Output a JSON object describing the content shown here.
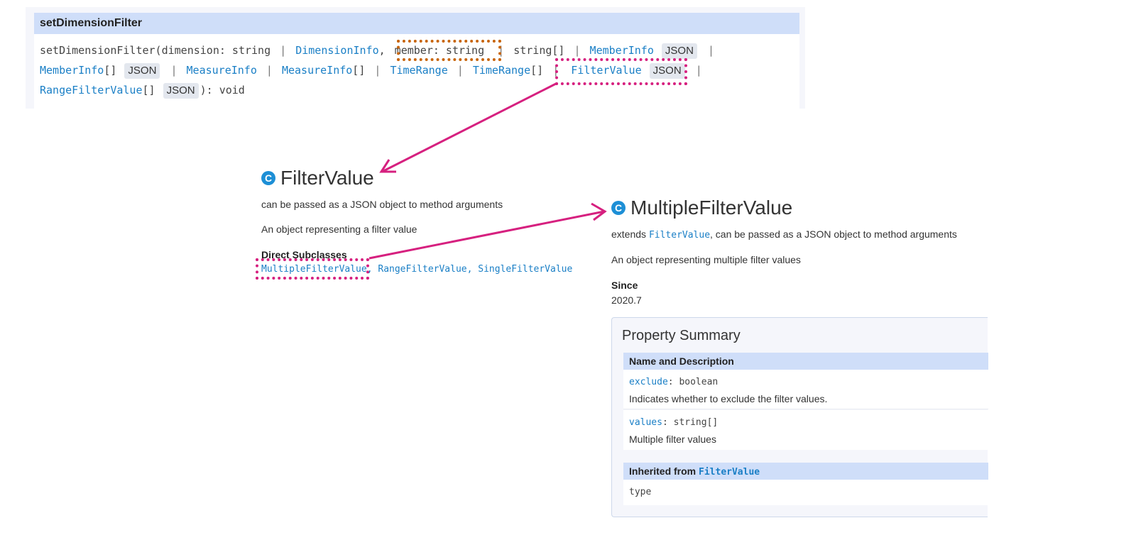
{
  "signature": {
    "header_title": "setDimensionFilter",
    "line1": {
      "fn": "setDimensionFilter(dimension: string",
      "sep1": "|",
      "dimension_info": "DimensionInfo",
      "comma": ",",
      "member_param": "member: string",
      "sep2": "|",
      "string_arr": "string[]",
      "sep3": "|",
      "member_info": "MemberInfo",
      "json1": "JSON",
      "sep4": "|"
    },
    "line2": {
      "member_info_arr": "MemberInfo",
      "brackets1": "[]",
      "json2": "JSON",
      "sep5": "|",
      "measure_info": "MeasureInfo",
      "sep6": "|",
      "measure_info_arr": "MeasureInfo",
      "brackets2": "[]",
      "sep7": "|",
      "time_range": "TimeRange",
      "sep8": "|",
      "time_range_arr": "TimeRange",
      "brackets3": "[]",
      "sep9": "|",
      "filter_value": "FilterValue",
      "json3": "JSON",
      "sep10": "|"
    },
    "line3": {
      "range_filter_value": "RangeFilterValue",
      "brackets4": "[]",
      "json4": "JSON",
      "tail": "): void"
    }
  },
  "filter_value_doc": {
    "class_icon": "C",
    "title": "FilterValue",
    "line1": "can be passed as a JSON object to method arguments",
    "line2": "An object representing a filter value",
    "subclasses_label": "Direct Subclasses",
    "subclasses": [
      "MultipleFilterValue",
      "RangeFilterValue",
      "SingleFilterValue"
    ],
    "subclass_sep": ","
  },
  "multiple_filter_value_doc": {
    "class_icon": "C",
    "title": "MultipleFilterValue",
    "extends_prefix": "extends",
    "extends_link": "FilterValue",
    "extends_suffix": ", can be passed as a JSON object to method arguments",
    "description": "An object representing multiple filter values",
    "since_label": "Since",
    "since_value": "2020.7"
  },
  "property_summary": {
    "title": "Property Summary",
    "column_header": "Name and Description",
    "properties": [
      {
        "name": "exclude",
        "type": ": boolean",
        "description": "Indicates whether to exclude the filter values."
      },
      {
        "name": "values",
        "type": ": string[]",
        "description": "Multiple filter values"
      }
    ],
    "inherited_label": "Inherited from",
    "inherited_link": "FilterValue",
    "inherited_props": [
      "type"
    ]
  },
  "colors": {
    "link": "#1a7fc6",
    "header_bg": "#cfdef9",
    "annotation_magenta": "#d6207f",
    "annotation_orange": "#c8650b",
    "class_icon": "#1d8fd6"
  }
}
